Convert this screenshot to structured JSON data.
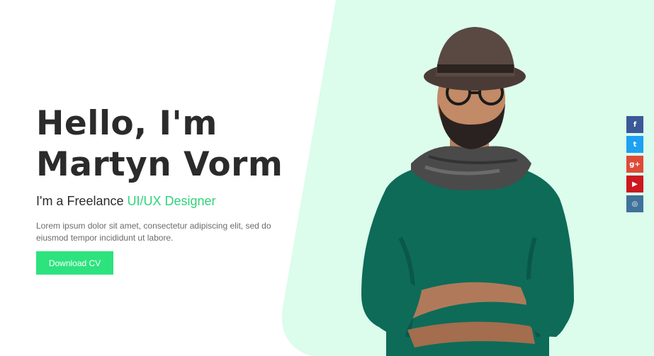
{
  "hero": {
    "greeting_line1": "Hello, I'm",
    "greeting_line2": "Martyn Vorm",
    "subtitle_prefix": "I'm a Freelance ",
    "subtitle_accent": "UI/UX Designer",
    "description": "Lorem ipsum dolor sit amet, consectetur adipiscing elit, sed do eiusmod tempor incididunt ut labore.",
    "cta_label": "Download CV"
  },
  "social": [
    {
      "name": "facebook-icon",
      "glyph": "f",
      "color": "#3b5998"
    },
    {
      "name": "twitter-icon",
      "glyph": "t",
      "color": "#1da1f2"
    },
    {
      "name": "google-plus-icon",
      "glyph": "g+",
      "color": "#dd4b39"
    },
    {
      "name": "youtube-icon",
      "glyph": "▶",
      "color": "#cc181e"
    },
    {
      "name": "instagram-icon",
      "glyph": "◎",
      "color": "#3f729b"
    }
  ],
  "colors": {
    "accent": "#2fd37a",
    "button": "#2de37e",
    "panel": "#dcfcec",
    "heading": "#2b2b2b"
  }
}
